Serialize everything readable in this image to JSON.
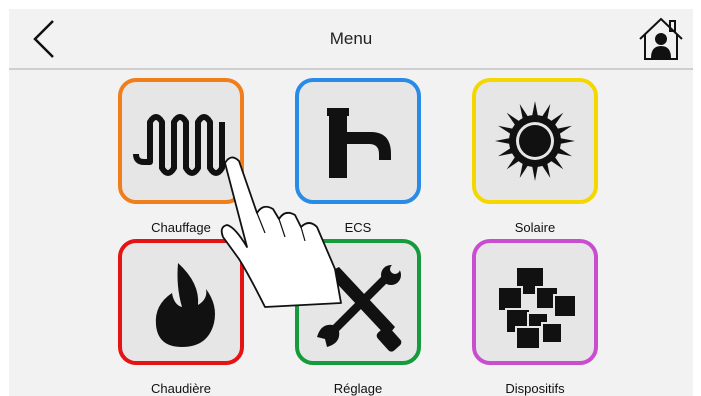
{
  "header": {
    "title": "Menu",
    "back_icon": "chevron-left-icon",
    "home_icon": "home-user-icon"
  },
  "tiles": [
    {
      "label": "Chauffage",
      "icon": "radiator-coil-icon",
      "color": "#f07f1b"
    },
    {
      "label": "ECS",
      "icon": "faucet-icon",
      "color": "#2a8be6"
    },
    {
      "label": "Solaire",
      "icon": "sun-icon",
      "color": "#f5d700"
    },
    {
      "label": "Chaudière",
      "icon": "flame-icon",
      "color": "#e41414"
    },
    {
      "label": "Réglage",
      "icon": "tools-icon",
      "color": "#159a3c"
    },
    {
      "label": "Dispositifs",
      "icon": "devices-icon",
      "color": "#c84ed0"
    }
  ],
  "overlay": {
    "icon": "pointing-hand-icon"
  }
}
